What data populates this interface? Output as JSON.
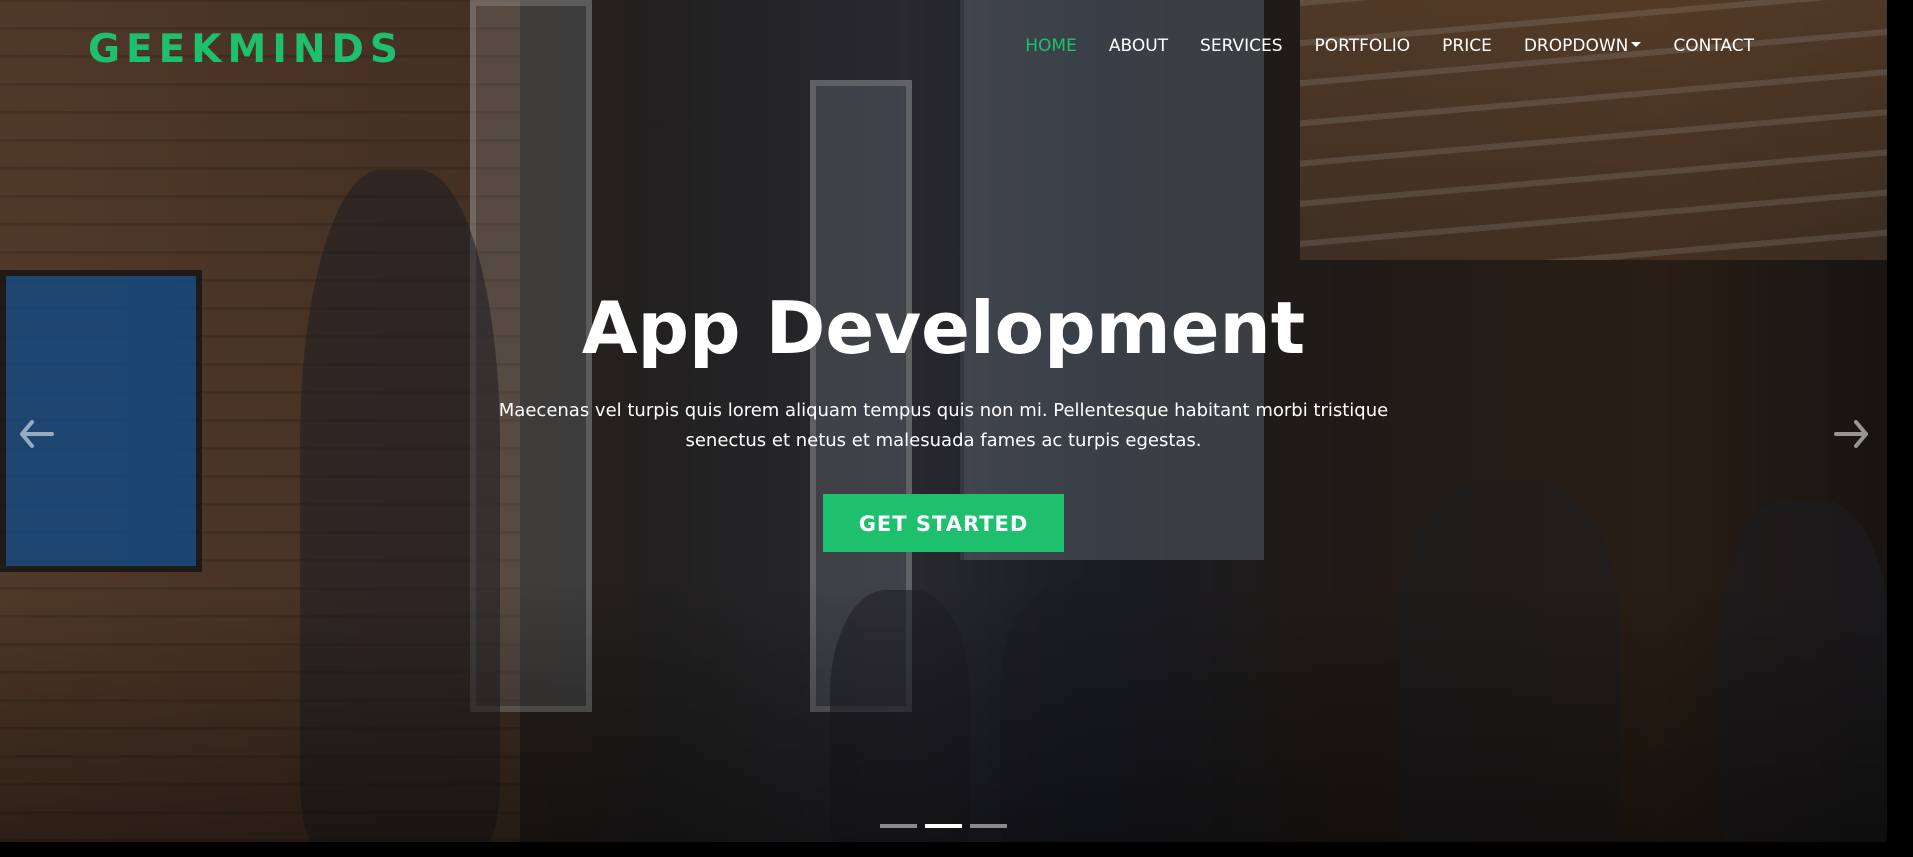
{
  "brand": {
    "logo_text": "GEEKMINDS",
    "accent_color": "#1ec06e"
  },
  "nav": {
    "items": [
      {
        "label": "HOME",
        "active": true
      },
      {
        "label": "ABOUT",
        "active": false
      },
      {
        "label": "SERVICES",
        "active": false
      },
      {
        "label": "PORTFOLIO",
        "active": false
      },
      {
        "label": "PRICE",
        "active": false
      },
      {
        "label": "DROPDOWN",
        "active": false,
        "has_dropdown": true
      },
      {
        "label": "CONTACT",
        "active": false
      }
    ]
  },
  "hero": {
    "title": "App Development",
    "description": "Maecenas vel turpis quis lorem aliquam tempus quis non mi. Pellentesque habitant morbi tristique senectus et netus et malesuada fames ac turpis egestas.",
    "cta_label": "GET STARTED",
    "prev_icon": "arrow-left-icon",
    "next_icon": "arrow-right-icon"
  },
  "carousel": {
    "slide_count": 3,
    "active_index": 1
  }
}
